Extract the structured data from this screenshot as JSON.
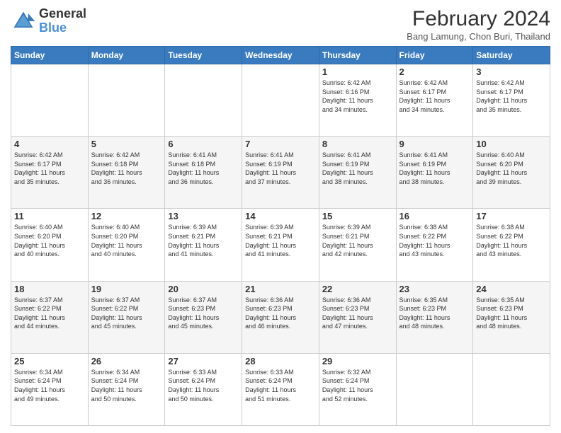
{
  "header": {
    "logo_line1": "General",
    "logo_line2": "Blue",
    "month_year": "February 2024",
    "location": "Bang Lamung, Chon Buri, Thailand"
  },
  "days_of_week": [
    "Sunday",
    "Monday",
    "Tuesday",
    "Wednesday",
    "Thursday",
    "Friday",
    "Saturday"
  ],
  "weeks": [
    [
      {
        "day": "",
        "info": ""
      },
      {
        "day": "",
        "info": ""
      },
      {
        "day": "",
        "info": ""
      },
      {
        "day": "",
        "info": ""
      },
      {
        "day": "1",
        "info": "Sunrise: 6:42 AM\nSunset: 6:16 PM\nDaylight: 11 hours\nand 34 minutes."
      },
      {
        "day": "2",
        "info": "Sunrise: 6:42 AM\nSunset: 6:17 PM\nDaylight: 11 hours\nand 34 minutes."
      },
      {
        "day": "3",
        "info": "Sunrise: 6:42 AM\nSunset: 6:17 PM\nDaylight: 11 hours\nand 35 minutes."
      }
    ],
    [
      {
        "day": "4",
        "info": "Sunrise: 6:42 AM\nSunset: 6:17 PM\nDaylight: 11 hours\nand 35 minutes."
      },
      {
        "day": "5",
        "info": "Sunrise: 6:42 AM\nSunset: 6:18 PM\nDaylight: 11 hours\nand 36 minutes."
      },
      {
        "day": "6",
        "info": "Sunrise: 6:41 AM\nSunset: 6:18 PM\nDaylight: 11 hours\nand 36 minutes."
      },
      {
        "day": "7",
        "info": "Sunrise: 6:41 AM\nSunset: 6:19 PM\nDaylight: 11 hours\nand 37 minutes."
      },
      {
        "day": "8",
        "info": "Sunrise: 6:41 AM\nSunset: 6:19 PM\nDaylight: 11 hours\nand 38 minutes."
      },
      {
        "day": "9",
        "info": "Sunrise: 6:41 AM\nSunset: 6:19 PM\nDaylight: 11 hours\nand 38 minutes."
      },
      {
        "day": "10",
        "info": "Sunrise: 6:40 AM\nSunset: 6:20 PM\nDaylight: 11 hours\nand 39 minutes."
      }
    ],
    [
      {
        "day": "11",
        "info": "Sunrise: 6:40 AM\nSunset: 6:20 PM\nDaylight: 11 hours\nand 40 minutes."
      },
      {
        "day": "12",
        "info": "Sunrise: 6:40 AM\nSunset: 6:20 PM\nDaylight: 11 hours\nand 40 minutes."
      },
      {
        "day": "13",
        "info": "Sunrise: 6:39 AM\nSunset: 6:21 PM\nDaylight: 11 hours\nand 41 minutes."
      },
      {
        "day": "14",
        "info": "Sunrise: 6:39 AM\nSunset: 6:21 PM\nDaylight: 11 hours\nand 41 minutes."
      },
      {
        "day": "15",
        "info": "Sunrise: 6:39 AM\nSunset: 6:21 PM\nDaylight: 11 hours\nand 42 minutes."
      },
      {
        "day": "16",
        "info": "Sunrise: 6:38 AM\nSunset: 6:22 PM\nDaylight: 11 hours\nand 43 minutes."
      },
      {
        "day": "17",
        "info": "Sunrise: 6:38 AM\nSunset: 6:22 PM\nDaylight: 11 hours\nand 43 minutes."
      }
    ],
    [
      {
        "day": "18",
        "info": "Sunrise: 6:37 AM\nSunset: 6:22 PM\nDaylight: 11 hours\nand 44 minutes."
      },
      {
        "day": "19",
        "info": "Sunrise: 6:37 AM\nSunset: 6:22 PM\nDaylight: 11 hours\nand 45 minutes."
      },
      {
        "day": "20",
        "info": "Sunrise: 6:37 AM\nSunset: 6:23 PM\nDaylight: 11 hours\nand 45 minutes."
      },
      {
        "day": "21",
        "info": "Sunrise: 6:36 AM\nSunset: 6:23 PM\nDaylight: 11 hours\nand 46 minutes."
      },
      {
        "day": "22",
        "info": "Sunrise: 6:36 AM\nSunset: 6:23 PM\nDaylight: 11 hours\nand 47 minutes."
      },
      {
        "day": "23",
        "info": "Sunrise: 6:35 AM\nSunset: 6:23 PM\nDaylight: 11 hours\nand 48 minutes."
      },
      {
        "day": "24",
        "info": "Sunrise: 6:35 AM\nSunset: 6:23 PM\nDaylight: 11 hours\nand 48 minutes."
      }
    ],
    [
      {
        "day": "25",
        "info": "Sunrise: 6:34 AM\nSunset: 6:24 PM\nDaylight: 11 hours\nand 49 minutes."
      },
      {
        "day": "26",
        "info": "Sunrise: 6:34 AM\nSunset: 6:24 PM\nDaylight: 11 hours\nand 50 minutes."
      },
      {
        "day": "27",
        "info": "Sunrise: 6:33 AM\nSunset: 6:24 PM\nDaylight: 11 hours\nand 50 minutes."
      },
      {
        "day": "28",
        "info": "Sunrise: 6:33 AM\nSunset: 6:24 PM\nDaylight: 11 hours\nand 51 minutes."
      },
      {
        "day": "29",
        "info": "Sunrise: 6:32 AM\nSunset: 6:24 PM\nDaylight: 11 hours\nand 52 minutes."
      },
      {
        "day": "",
        "info": ""
      },
      {
        "day": "",
        "info": ""
      }
    ]
  ]
}
